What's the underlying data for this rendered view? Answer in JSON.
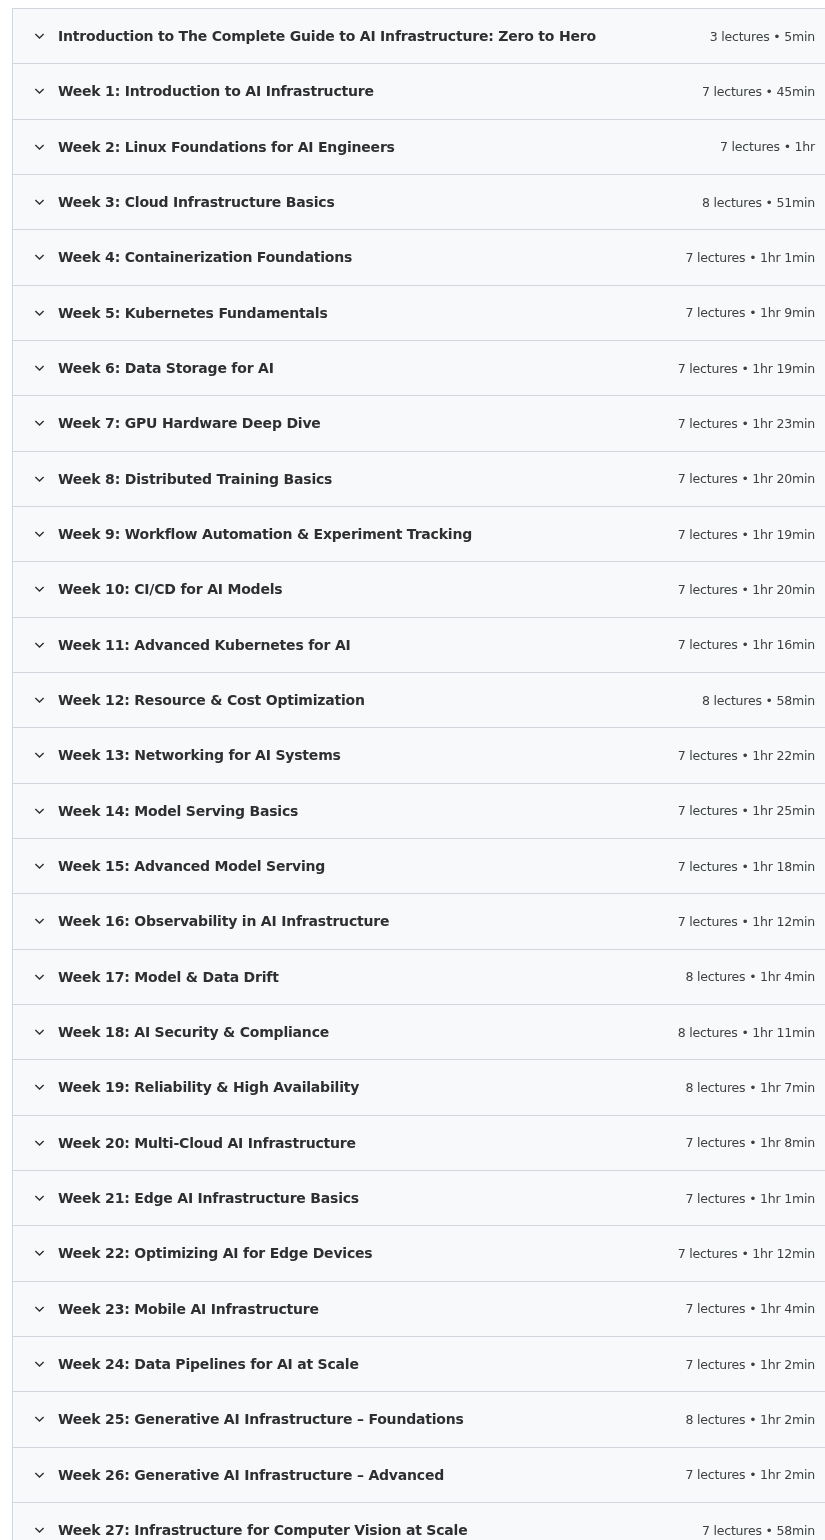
{
  "sections": [
    {
      "title": "Introduction to The Complete Guide to AI Infrastructure: Zero to Hero",
      "meta": "3 lectures • 5min",
      "expanded": false
    },
    {
      "title": "Week 1: Introduction to AI Infrastructure",
      "meta": "7 lectures • 45min",
      "expanded": false
    },
    {
      "title": "Week 2: Linux Foundations for AI Engineers",
      "meta": "7 lectures • 1hr",
      "expanded": false
    },
    {
      "title": "Week 3: Cloud Infrastructure Basics",
      "meta": "8 lectures • 51min",
      "expanded": false
    },
    {
      "title": "Week 4: Containerization Foundations",
      "meta": "7 lectures • 1hr 1min",
      "expanded": false
    },
    {
      "title": "Week 5: Kubernetes Fundamentals",
      "meta": "7 lectures • 1hr 9min",
      "expanded": false
    },
    {
      "title": "Week 6: Data Storage for AI",
      "meta": "7 lectures • 1hr 19min",
      "expanded": false
    },
    {
      "title": "Week 7: GPU Hardware Deep Dive",
      "meta": "7 lectures • 1hr 23min",
      "expanded": false
    },
    {
      "title": "Week 8: Distributed Training Basics",
      "meta": "7 lectures • 1hr 20min",
      "expanded": false
    },
    {
      "title": "Week 9: Workflow Automation & Experiment Tracking",
      "meta": "7 lectures • 1hr 19min",
      "expanded": false
    },
    {
      "title": "Week 10: CI/CD for AI Models",
      "meta": "7 lectures • 1hr 20min",
      "expanded": false
    },
    {
      "title": "Week 11: Advanced Kubernetes for AI",
      "meta": "7 lectures • 1hr 16min",
      "expanded": false
    },
    {
      "title": "Week 12: Resource & Cost Optimization",
      "meta": "8 lectures • 58min",
      "expanded": false
    },
    {
      "title": "Week 13: Networking for AI Systems",
      "meta": "7 lectures • 1hr 22min",
      "expanded": false
    },
    {
      "title": "Week 14: Model Serving Basics",
      "meta": "7 lectures • 1hr 25min",
      "expanded": false
    },
    {
      "title": "Week 15: Advanced Model Serving",
      "meta": "7 lectures • 1hr 18min",
      "expanded": false
    },
    {
      "title": "Week 16: Observability in AI Infrastructure",
      "meta": "7 lectures • 1hr 12min",
      "expanded": false
    },
    {
      "title": "Week 17: Model & Data Drift",
      "meta": "8 lectures • 1hr 4min",
      "expanded": false
    },
    {
      "title": "Week 18: AI Security & Compliance",
      "meta": "8 lectures • 1hr 11min",
      "expanded": false
    },
    {
      "title": "Week 19: Reliability & High Availability",
      "meta": "8 lectures • 1hr 7min",
      "expanded": false
    },
    {
      "title": "Week 20: Multi-Cloud AI Infrastructure",
      "meta": "7 lectures • 1hr 8min",
      "expanded": false
    },
    {
      "title": "Week 21: Edge AI Infrastructure Basics",
      "meta": "7 lectures • 1hr 1min",
      "expanded": false
    },
    {
      "title": "Week 22: Optimizing AI for Edge Devices",
      "meta": "7 lectures • 1hr 12min",
      "expanded": false
    },
    {
      "title": "Week 23: Mobile AI Infrastructure",
      "meta": "7 lectures • 1hr 4min",
      "expanded": false
    },
    {
      "title": "Week 24: Data Pipelines for AI at Scale",
      "meta": "7 lectures • 1hr 2min",
      "expanded": false
    },
    {
      "title": "Week 25: Generative AI Infrastructure – Foundations",
      "meta": "8 lectures • 1hr 2min",
      "expanded": false
    },
    {
      "title": "Week 26: Generative AI Infrastructure – Advanced",
      "meta": "7 lectures • 1hr 2min",
      "expanded": false
    },
    {
      "title": "Week 27: Infrastructure for Computer Vision at Scale",
      "meta": "7 lectures • 58min",
      "expanded": false
    }
  ]
}
